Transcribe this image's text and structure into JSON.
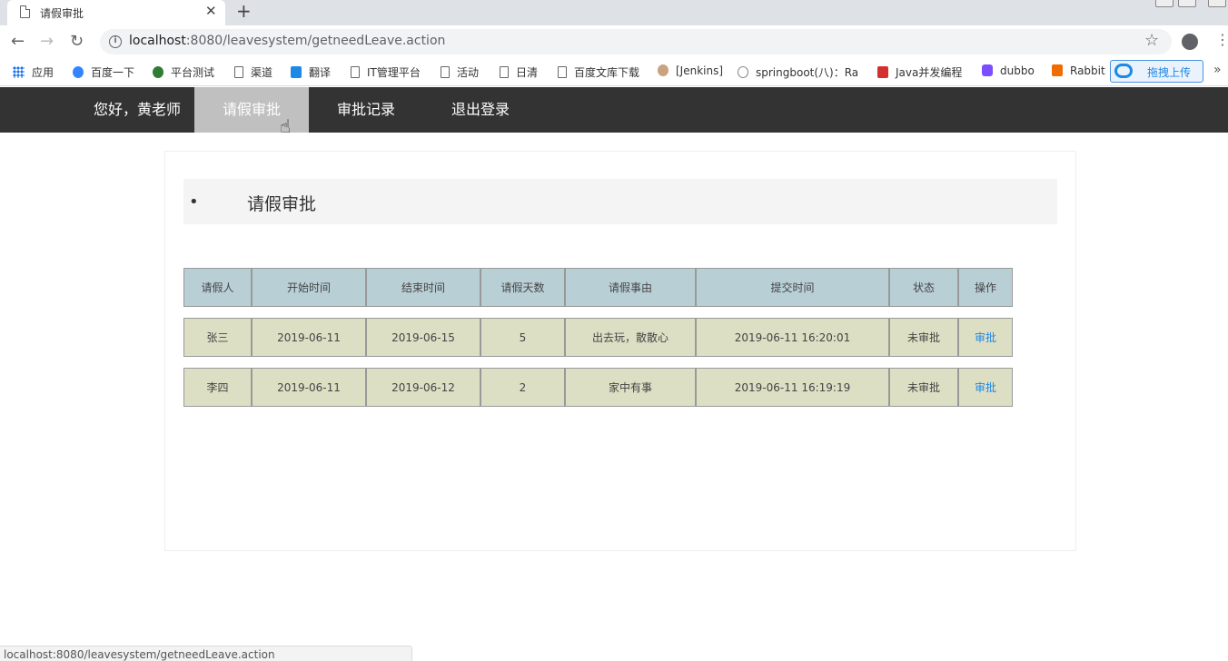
{
  "browser": {
    "tab_title": "请假审批",
    "url_host": "localhost",
    "url_rest": ":8080/leavesystem/getneedLeave.action",
    "bookmarks": [
      "应用",
      "百度一下",
      "平台测试",
      "渠道",
      "翻译",
      "IT管理平台",
      "活动",
      "日清",
      "百度文库下载",
      "[Jenkins]",
      "springboot(八)：Ra",
      "Java并发编程",
      "dubbo",
      "Rabbit"
    ],
    "upload_label": "拖拽上传",
    "status_url": "localhost:8080/leavesystem/getneedLeave.action"
  },
  "nav": {
    "greeting": "您好，黄老师",
    "items": [
      "请假审批",
      "审批记录",
      "退出登录"
    ]
  },
  "section": {
    "title": "请假审批"
  },
  "table": {
    "headers": [
      "请假人",
      "开始时间",
      "结束时间",
      "请假天数",
      "请假事由",
      "提交时间",
      "状态",
      "操作"
    ],
    "rows": [
      [
        "张三",
        "2019-06-11",
        "2019-06-15",
        "5",
        "出去玩，散散心",
        "2019-06-11 16:20:01",
        "未审批",
        "审批"
      ],
      [
        "李四",
        "2019-06-11",
        "2019-06-12",
        "2",
        "家中有事",
        "2019-06-11 16:19:19",
        "未审批",
        "审批"
      ]
    ]
  },
  "colors": {
    "nav_bg": "#333333",
    "nav_active": "#c0c0c0",
    "header_bg": "#b9cfd6",
    "row_bg": "#dddfc4",
    "link": "#1e88e5"
  }
}
